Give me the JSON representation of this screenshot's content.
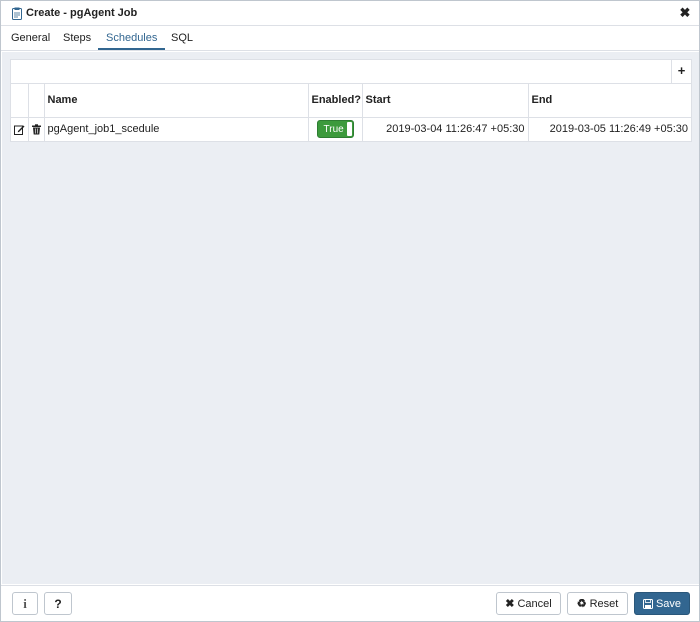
{
  "dialog": {
    "title": "Create - pgAgent Job"
  },
  "tabs": [
    {
      "label": "General"
    },
    {
      "label": "Steps"
    },
    {
      "label": "Schedules"
    },
    {
      "label": "SQL"
    }
  ],
  "active_tab": "Schedules",
  "schedules": {
    "columns": [
      "Name",
      "Enabled?",
      "Start",
      "End"
    ],
    "rows": [
      {
        "name": "pgAgent_job1_scedule",
        "enabled": "True",
        "start": "2019-03-04 11:26:47 +05:30",
        "end": "2019-03-05 11:26:49 +05:30"
      }
    ],
    "add_icon": "+"
  },
  "footer": {
    "info_icon": "i",
    "help_icon": "?",
    "cancel_label": "Cancel",
    "reset_label": "Reset",
    "save_label": "Save"
  },
  "colors": {
    "accent": "#326690",
    "enabled_green": "#3c9a3c",
    "content_bg": "#ebeef3"
  },
  "icons": {
    "title": "clipboard-icon",
    "close": "close-icon",
    "edit": "edit-icon",
    "delete": "trash-icon",
    "cancel": "x-icon",
    "reset": "recycle-icon",
    "save": "floppy-disk-icon"
  }
}
